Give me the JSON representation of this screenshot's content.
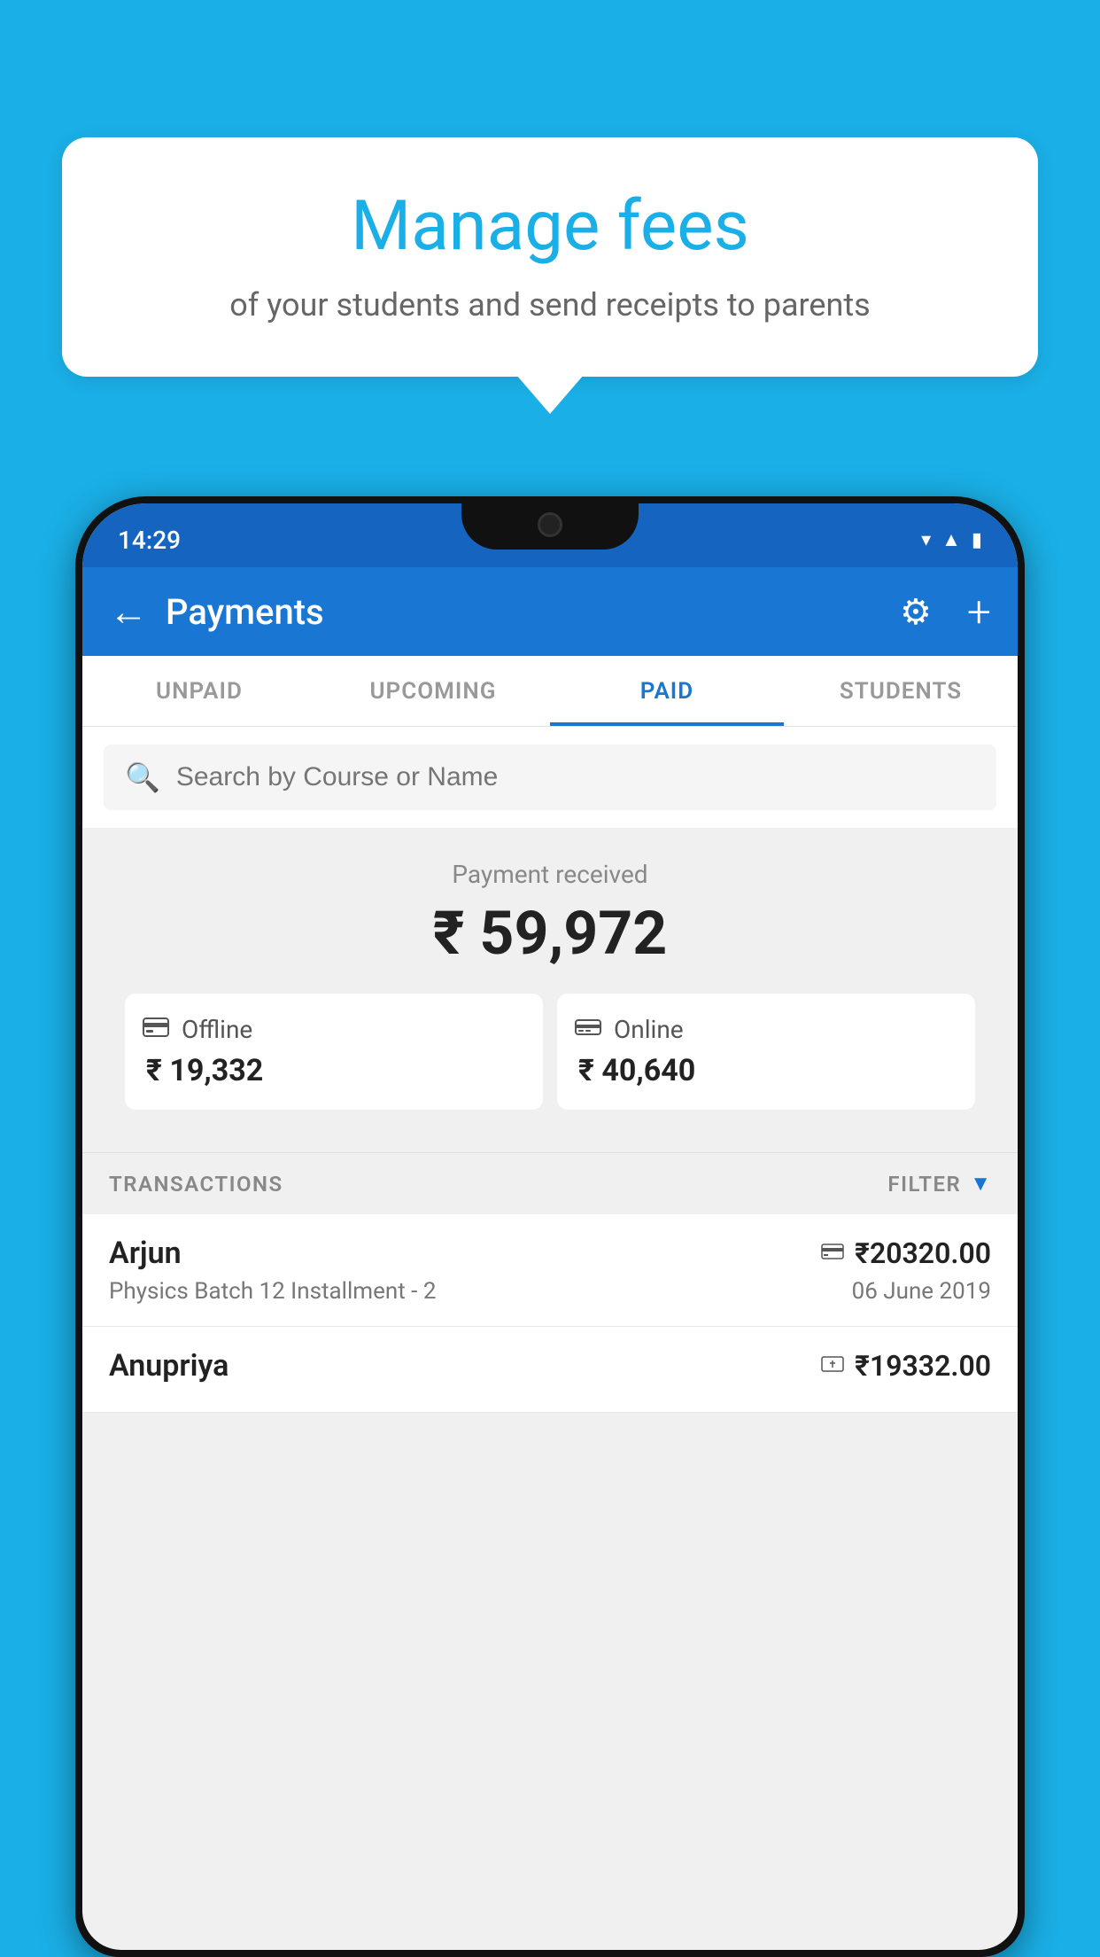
{
  "background_color": "#1AAFE6",
  "bubble": {
    "title": "Manage fees",
    "subtitle": "of your students and send receipts to parents"
  },
  "status_bar": {
    "time": "14:29",
    "wifi": "▾",
    "signal": "▾",
    "battery": "▮"
  },
  "header": {
    "title": "Payments",
    "back_icon": "←",
    "gear_icon": "⚙",
    "plus_icon": "+"
  },
  "tabs": [
    {
      "label": "UNPAID",
      "active": false
    },
    {
      "label": "UPCOMING",
      "active": false
    },
    {
      "label": "PAID",
      "active": true
    },
    {
      "label": "STUDENTS",
      "active": false
    }
  ],
  "search": {
    "placeholder": "Search by Course or Name"
  },
  "payment_received": {
    "label": "Payment received",
    "amount": "₹ 59,972"
  },
  "payment_cards": [
    {
      "icon": "💳",
      "label": "Offline",
      "amount": "₹ 19,332"
    },
    {
      "icon": "💳",
      "label": "Online",
      "amount": "₹ 40,640"
    }
  ],
  "transactions": {
    "label": "TRANSACTIONS",
    "filter_label": "FILTER",
    "items": [
      {
        "name": "Arjun",
        "course": "Physics Batch 12 Installment - 2",
        "amount": "₹20320.00",
        "date": "06 June 2019",
        "payment_type": "online"
      },
      {
        "name": "Anupriya",
        "course": "",
        "amount": "₹19332.00",
        "date": "",
        "payment_type": "offline"
      }
    ]
  }
}
